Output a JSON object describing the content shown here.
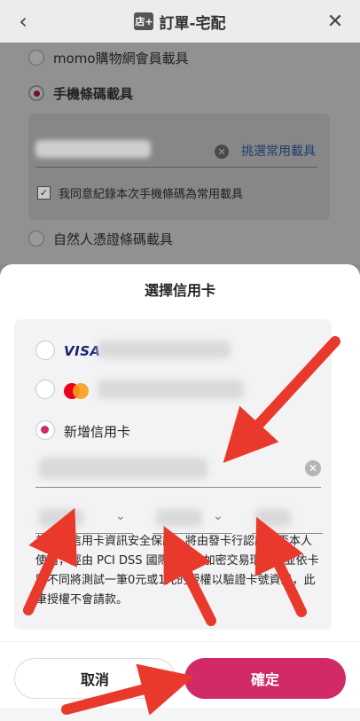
{
  "header": {
    "back_icon": "chevron-left-icon",
    "store_icon_text": "店+",
    "title": "訂單-宅配",
    "close_icon": "close-icon"
  },
  "background": {
    "carrier_options": [
      {
        "label": "momo購物網會員載具",
        "selected": false
      },
      {
        "label": "手機條碼載具",
        "selected": true
      },
      {
        "label": "自然人憑證條碼載具",
        "selected": false
      }
    ],
    "pick_common_link": "挑選常用載具",
    "remember_checkbox_label": "我同意紀錄本次手機條碼為常用載具",
    "remember_checked": true
  },
  "sheet": {
    "title": "選擇信用卡",
    "cards": [
      {
        "brand": "VISA",
        "selected": false
      },
      {
        "brand": "MasterCard",
        "selected": false
      }
    ],
    "new_card_label": "新增信用卡",
    "new_card_selected": true,
    "notice": "為確保信用卡資訊安全保護，將由發卡行認證是否本人使用，經由 PCI DSS 國際認證之加密交易環境，並依卡別不同將測試一筆0元或1元的授權以驗證卡號資訊，此筆授權不會請款。",
    "cancel_label": "取消",
    "confirm_label": "確定"
  },
  "colors": {
    "accent": "#d12a66",
    "arrow": "#e8392c"
  }
}
